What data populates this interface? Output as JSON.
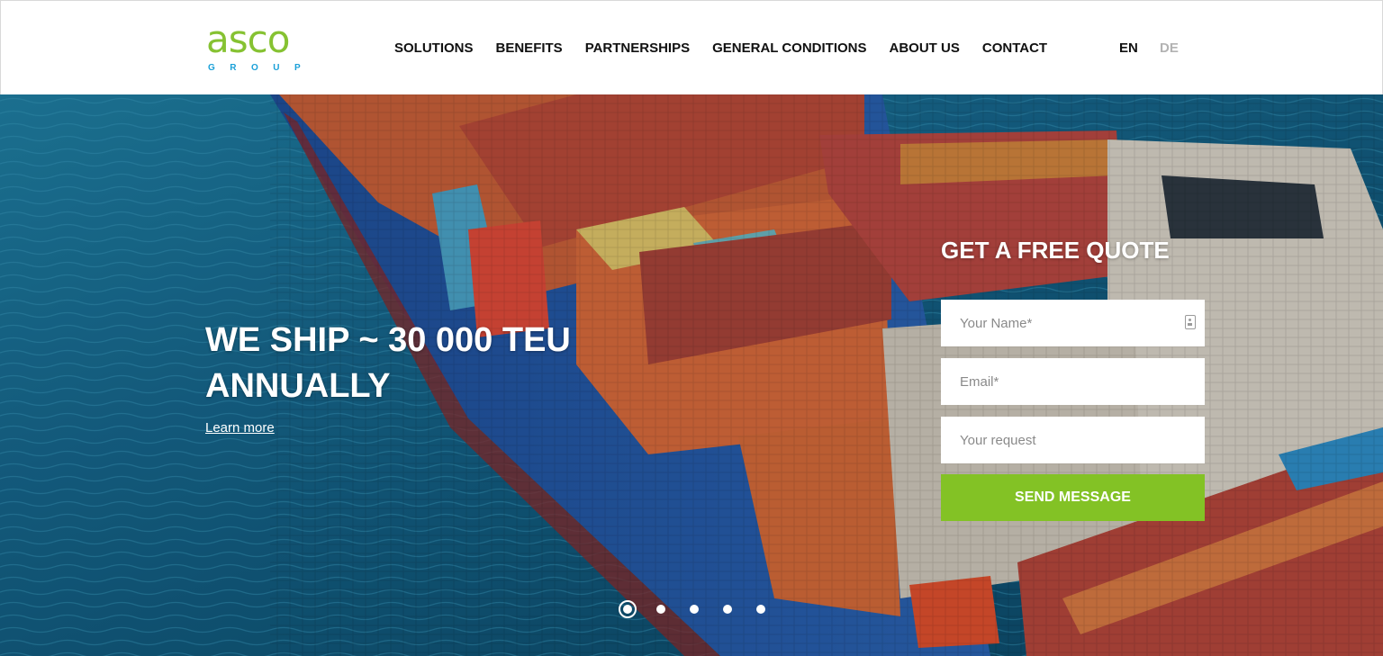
{
  "brand": {
    "logo_word": "asco",
    "logo_sub": "GROUP"
  },
  "nav": {
    "items": [
      {
        "label": "SOLUTIONS"
      },
      {
        "label": "BENEFITS"
      },
      {
        "label": "PARTNERSHIPS"
      },
      {
        "label": "GENERAL CONDITIONS"
      },
      {
        "label": "ABOUT US"
      },
      {
        "label": "CONTACT"
      }
    ],
    "languages": {
      "en": "EN",
      "de": "DE",
      "active": "EN"
    }
  },
  "hero": {
    "title": "WE SHIP ~ 30 000 TEU ANNUALLY",
    "link_label": "Learn more",
    "slides_count": 5,
    "active_slide": 1
  },
  "quote_form": {
    "title": "GET A FREE QUOTE",
    "name_placeholder": "Your Name*",
    "email_placeholder": "Email*",
    "request_placeholder": "Your request",
    "submit_label": "SEND MESSAGE"
  },
  "colors": {
    "accent_green": "#83c225",
    "logo_green": "#86c232",
    "logo_blue": "#1aa0d8",
    "sea": "#16668c",
    "nav_text": "#111111",
    "inactive_lang": "#b3b3b3"
  }
}
